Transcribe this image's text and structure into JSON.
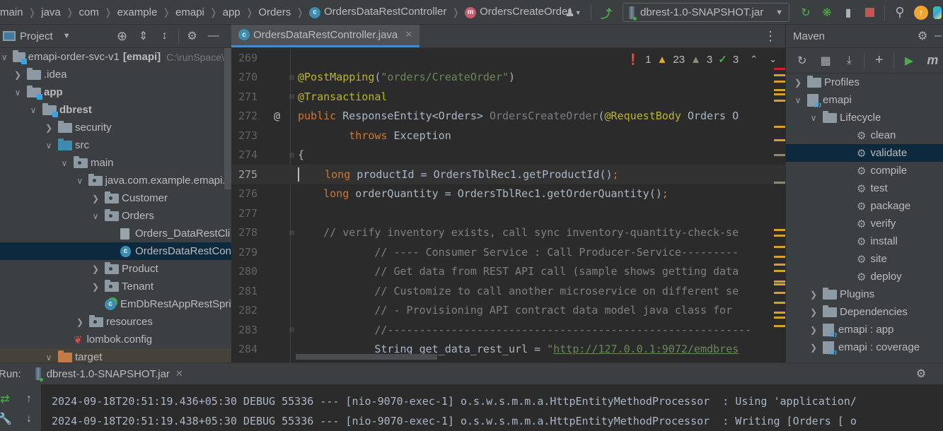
{
  "navbar": {
    "breadcrumbs": [
      "main",
      "java",
      "com",
      "example",
      "emapi",
      "app",
      "Orders"
    ],
    "class_crumb": "OrdersDataRestController",
    "method_crumb": "OrdersCreateOrder",
    "class_badge": "c",
    "method_badge": "m",
    "run_config": "dbrest-1.0-SNAPSHOT.jar",
    "icons": [
      "user-icon",
      "build-hammer-icon",
      "rerun-icon",
      "debug-icon",
      "coverage-icon",
      "stop-icon",
      "search-icon",
      "update-icon",
      "plugin-icon"
    ]
  },
  "project": {
    "title": "Project",
    "tree": [
      {
        "label": "emapi-order-svc-v1",
        "suffix": "[emapi]",
        "path": "C:\\runSpace\\w",
        "depth": 0,
        "expanded": true,
        "icon": "module-folder"
      },
      {
        "label": ".idea",
        "depth": 1,
        "expanded": false,
        "icon": "folder"
      },
      {
        "label": "app",
        "depth": 1,
        "expanded": true,
        "icon": "module-folder",
        "bold": true
      },
      {
        "label": "dbrest",
        "depth": 2,
        "expanded": true,
        "icon": "module-folder",
        "bold": true
      },
      {
        "label": "security",
        "depth": 3,
        "expanded": false,
        "icon": "folder"
      },
      {
        "label": "src",
        "depth": 3,
        "expanded": true,
        "icon": "source-folder"
      },
      {
        "label": "main",
        "depth": 4,
        "expanded": true,
        "icon": "package-folder"
      },
      {
        "label": "java.com.example.emapi.a",
        "depth": 5,
        "expanded": true,
        "icon": "package-folder"
      },
      {
        "label": "Customer",
        "depth": 6,
        "expanded": false,
        "icon": "package-folder"
      },
      {
        "label": "Orders",
        "depth": 6,
        "expanded": true,
        "icon": "package-folder"
      },
      {
        "label": "Orders_DataRestCli",
        "depth": 7,
        "icon": "text-file"
      },
      {
        "label": "OrdersDataRestCon",
        "depth": 7,
        "icon": "class",
        "selected": true
      },
      {
        "label": "Product",
        "depth": 6,
        "expanded": false,
        "icon": "package-folder"
      },
      {
        "label": "Tenant",
        "depth": 6,
        "expanded": false,
        "icon": "package-folder"
      },
      {
        "label": "EmDbRestAppRestSpri",
        "depth": 6,
        "icon": "spring-class"
      },
      {
        "label": "resources",
        "depth": 5,
        "expanded": false,
        "icon": "package-folder"
      },
      {
        "label": "lombok.config",
        "depth": 4,
        "icon": "lombok-file"
      },
      {
        "label": "target",
        "depth": 3,
        "expanded": true,
        "icon": "target-folder"
      }
    ]
  },
  "editor": {
    "tab_label": "OrdersDataRestController.java",
    "inspections": {
      "errors": "1",
      "warnings": "23",
      "weak_warnings": "3",
      "typos": "3"
    },
    "lines": [
      {
        "n": "269",
        "tokens": []
      },
      {
        "n": "270",
        "fold": "open",
        "tokens": [
          {
            "t": "@PostMapping",
            "c": "ann"
          },
          {
            "t": "(",
            "c": "ctext"
          },
          {
            "t": "\"orders/CreateOrder\"",
            "c": "str"
          },
          {
            "t": ")",
            "c": "ctext"
          }
        ]
      },
      {
        "n": "271",
        "fold": "close",
        "tokens": [
          {
            "t": "@Transactional",
            "c": "ann"
          }
        ]
      },
      {
        "n": "272",
        "gutter": "@",
        "tokens": [
          {
            "t": "public ",
            "c": "kw"
          },
          {
            "t": "ResponseEntity<Orders> ",
            "c": "ctext"
          },
          {
            "t": "OrdersCreateOrder",
            "c": "mname"
          },
          {
            "t": "(",
            "c": "ctext"
          },
          {
            "t": "@RequestBody",
            "c": "ann"
          },
          {
            "t": " Orders O",
            "c": "ctext"
          }
        ]
      },
      {
        "n": "273",
        "tokens": [
          {
            "t": "        throws ",
            "c": "kw"
          },
          {
            "t": "Exception",
            "c": "ctext"
          }
        ]
      },
      {
        "n": "274",
        "fold": "open",
        "tokens": [
          {
            "t": "{",
            "c": "ctext"
          }
        ]
      },
      {
        "n": "275",
        "current": true,
        "caret": true,
        "tokens": [
          {
            "t": "    long ",
            "c": "kw"
          },
          {
            "t": "productId = OrdersTblRec1.getProductId()",
            "c": "ctext"
          },
          {
            "t": ";",
            "c": "kw"
          }
        ]
      },
      {
        "n": "276",
        "tokens": [
          {
            "t": "    long ",
            "c": "kw"
          },
          {
            "t": "orderQuantity = OrdersTblRec1.getOrderQuantity()",
            "c": "ctext"
          },
          {
            "t": ";",
            "c": "kw"
          }
        ]
      },
      {
        "n": "277",
        "tokens": []
      },
      {
        "n": "278",
        "fold": "open",
        "tokens": [
          {
            "t": "    // verify inventory exists, call sync inventory-quantity-check-se",
            "c": "cmt"
          }
        ]
      },
      {
        "n": "279",
        "tokens": [
          {
            "t": "            // ---- Consumer Service : Call Producer-Service---------",
            "c": "cmt"
          }
        ]
      },
      {
        "n": "280",
        "tokens": [
          {
            "t": "            // Get data from REST API call (sample shows getting data",
            "c": "cmt"
          }
        ]
      },
      {
        "n": "281",
        "tokens": [
          {
            "t": "            // Customize to call another microservice on different se",
            "c": "cmt"
          }
        ]
      },
      {
        "n": "282",
        "tokens": [
          {
            "t": "            // - Provisioning API contract data model java class for ",
            "c": "cmt"
          }
        ]
      },
      {
        "n": "283",
        "fold": "close",
        "tokens": [
          {
            "t": "            //---------------------------------------------------------",
            "c": "cmt"
          }
        ]
      },
      {
        "n": "284",
        "tokens": [
          {
            "t": "            String get_data_rest_url = ",
            "c": "ctext"
          },
          {
            "t": "\"",
            "c": "str"
          },
          {
            "t": "http://127.0.0.1:9072/emdbres",
            "c": "url"
          }
        ]
      }
    ]
  },
  "maven": {
    "title": "Maven",
    "tree": [
      {
        "label": "Profiles",
        "depth": 0,
        "expanded": false,
        "icon": "profiles"
      },
      {
        "label": "emapi",
        "depth": 0,
        "expanded": true,
        "icon": "maven-module"
      },
      {
        "label": "Lifecycle",
        "depth": 1,
        "expanded": true,
        "icon": "lifecycle-folder"
      },
      {
        "label": "clean",
        "depth": 2,
        "icon": "gear"
      },
      {
        "label": "validate",
        "depth": 2,
        "icon": "gear",
        "selected": true
      },
      {
        "label": "compile",
        "depth": 2,
        "icon": "gear"
      },
      {
        "label": "test",
        "depth": 2,
        "icon": "gear"
      },
      {
        "label": "package",
        "depth": 2,
        "icon": "gear"
      },
      {
        "label": "verify",
        "depth": 2,
        "icon": "gear"
      },
      {
        "label": "install",
        "depth": 2,
        "icon": "gear"
      },
      {
        "label": "site",
        "depth": 2,
        "icon": "gear"
      },
      {
        "label": "deploy",
        "depth": 2,
        "icon": "gear"
      },
      {
        "label": "Plugins",
        "depth": 1,
        "expanded": false,
        "icon": "plugins-folder"
      },
      {
        "label": "Dependencies",
        "depth": 1,
        "expanded": false,
        "icon": "dependencies-folder"
      },
      {
        "label": "emapi : app",
        "depth": 1,
        "expanded": false,
        "icon": "maven-module"
      },
      {
        "label": "emapi : coverage",
        "depth": 1,
        "expanded": false,
        "icon": "maven-module"
      }
    ]
  },
  "run": {
    "label": "Run:",
    "tab_label": "dbrest-1.0-SNAPSHOT.jar",
    "log": [
      "2024-09-18T20:51:19.436+05:30 DEBUG 55336 --- [nio-9070-exec-1] o.s.w.s.m.m.a.HttpEntityMethodProcessor  : Using 'application/",
      "2024-09-18T20:51:19.438+05:30 DEBUG 55336 --- [nio-9070-exec-1] o.s.w.s.m.m.a.HttpEntityMethodProcessor  : Writing [Orders [ o"
    ]
  }
}
